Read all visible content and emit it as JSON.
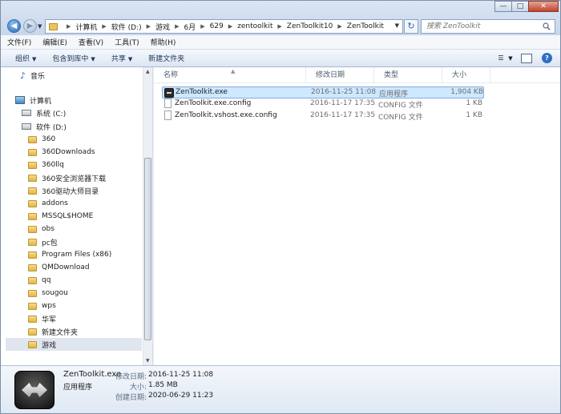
{
  "window": {
    "minimize": "—",
    "maximize": "□",
    "close": "✕"
  },
  "address": {
    "crumbs": [
      "计算机",
      "软件 (D:)",
      "游戏",
      "6月",
      "629",
      "zentoolkit",
      "ZenToolkit10",
      "ZenToolkit"
    ],
    "search_placeholder": "搜索 ZenToolkit"
  },
  "menu": [
    "文件(F)",
    "编辑(E)",
    "查看(V)",
    "工具(T)",
    "帮助(H)"
  ],
  "toolbar": [
    "组织",
    "包含到库中",
    "共享",
    "新建文件夹"
  ],
  "nav": {
    "music": "音乐",
    "computer": "计算机",
    "drives": [
      "系统 (C:)",
      "软件 (D:)"
    ],
    "folders": [
      "360",
      "360Downloads",
      "360llq",
      "360安全浏览器下载",
      "360驱动大师目录",
      "addons",
      "MSSQL$HOME",
      "obs",
      "pc包",
      "Program Files (x86)",
      "QMDownload",
      "qq",
      "sougou",
      "wps",
      "华军",
      "新建文件夹",
      "游戏"
    ],
    "selected": "游戏"
  },
  "columns": [
    "名称",
    "修改日期",
    "类型",
    "大小"
  ],
  "files": [
    {
      "name": "ZenToolkit.exe",
      "date": "2016-11-25 11:08",
      "type": "应用程序",
      "size": "1,904 KB",
      "icon": "exe-icon"
    },
    {
      "name": "ZenToolkit.exe.config",
      "date": "2016-11-17 17:35",
      "type": "CONFIG 文件",
      "size": "1 KB",
      "icon": "document-icon"
    },
    {
      "name": "ZenToolkit.vshost.exe.config",
      "date": "2016-11-17 17:35",
      "type": "CONFIG 文件",
      "size": "1 KB",
      "icon": "document-icon"
    }
  ],
  "details": {
    "name": "ZenToolkit.exe",
    "kind": "应用程序",
    "modified_label": "修改日期:",
    "modified": "2016-11-25 11:08",
    "size_label": "大小:",
    "size": "1.85 MB",
    "created_label": "创建日期:",
    "created": "2020-06-29 11:23"
  }
}
